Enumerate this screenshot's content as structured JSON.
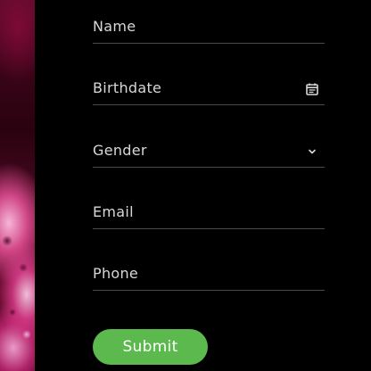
{
  "form": {
    "fields": [
      {
        "label": "Name"
      },
      {
        "label": "Birthdate",
        "icon": "calendar-icon"
      },
      {
        "label": "Gender",
        "icon": "chevron-down-icon"
      },
      {
        "label": "Email"
      },
      {
        "label": "Phone"
      }
    ],
    "submit_label": "Submit"
  },
  "colors": {
    "background": "#000000",
    "field_text": "#d8d8d8",
    "field_underline": "#4a4a4a",
    "submit_bg": "#5cb94d",
    "submit_text": "#ffffff"
  }
}
